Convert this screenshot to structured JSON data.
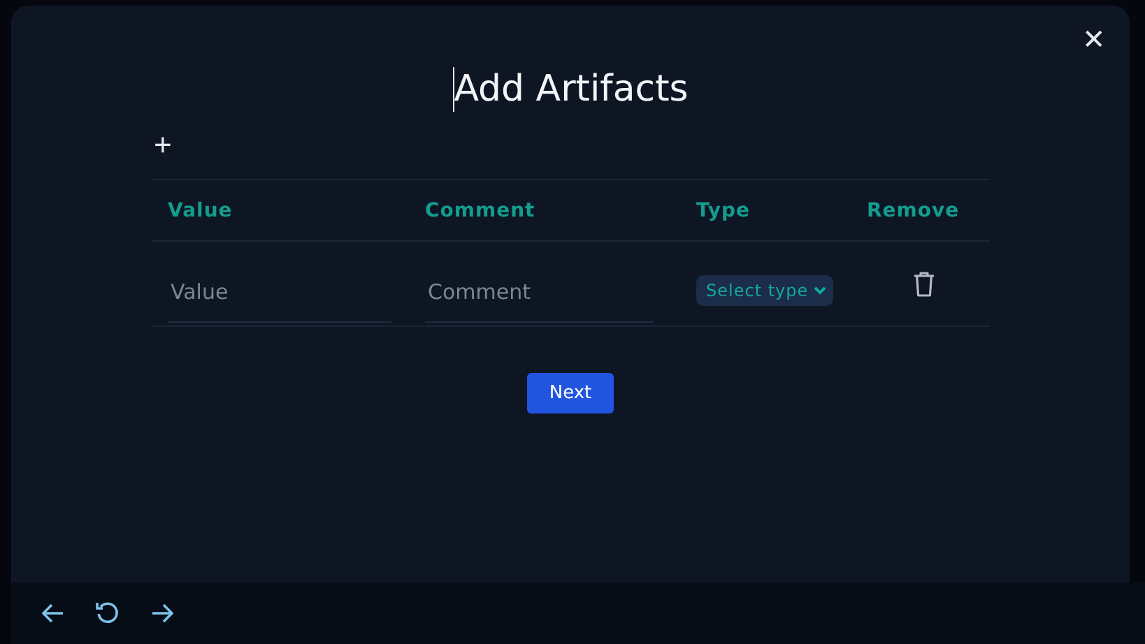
{
  "dialog": {
    "title": "Add Artifacts",
    "add_label": "+",
    "close_label": "✕"
  },
  "table": {
    "columns": [
      "Value",
      "Comment",
      "Type",
      "Remove"
    ],
    "rows": [
      {
        "value": {
          "placeholder": "Value"
        },
        "comment": {
          "placeholder": "Comment"
        },
        "type": {
          "placeholder": "Select type"
        }
      }
    ]
  },
  "next_button": "Next"
}
